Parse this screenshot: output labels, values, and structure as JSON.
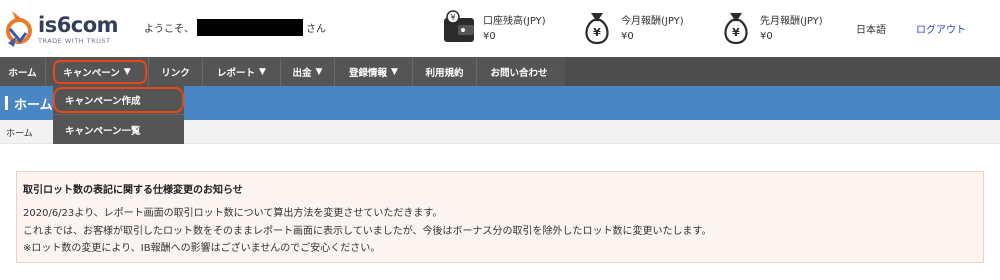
{
  "header": {
    "logo": {
      "name": "is6com",
      "tagline": "TRADE WITH TRUST"
    },
    "welcome_prefix": "ようこそ、",
    "welcome_suffix": "さん",
    "balances": [
      {
        "label": "口座残高(JPY)",
        "value": "¥0",
        "icon": "wallet-icon"
      },
      {
        "label": "今月報酬(JPY)",
        "value": "¥0",
        "icon": "money-bag-icon"
      },
      {
        "label": "先月報酬(JPY)",
        "value": "¥0",
        "icon": "money-bag-icon"
      }
    ],
    "language": "日本語",
    "logout": "ログアウト"
  },
  "nav": {
    "items": [
      {
        "label": "ホーム",
        "has_caret": false
      },
      {
        "label": "キャンペーン",
        "has_caret": true
      },
      {
        "label": "リンク",
        "has_caret": false
      },
      {
        "label": "レポート",
        "has_caret": true
      },
      {
        "label": "出金",
        "has_caret": true
      },
      {
        "label": "登録情報",
        "has_caret": true
      },
      {
        "label": "利用規約",
        "has_caret": false
      },
      {
        "label": "お問い合わせ",
        "has_caret": false
      }
    ],
    "caret": "▼"
  },
  "dropdown": {
    "items": [
      {
        "label": "キャンペーン作成"
      },
      {
        "label": "キャンペーン一覧"
      }
    ]
  },
  "page": {
    "title": "ホーム",
    "breadcrumb": "ホーム"
  },
  "notice": {
    "title": "取引ロット数の表記に関する仕様変更のお知らせ",
    "lines": [
      "2020/6/23より、レポート画面の取引ロット数について算出方法を変更させていただきます。",
      "これまでは、お客様が取引したロット数をそのままレポート画面に表示していましたが、今後はボーナス分の取引を除外したロット数に変更いたします。",
      "※ロット数の変更により、IB報酬への影響はございませんのでご安心ください。"
    ]
  },
  "colors": {
    "nav_bg": "#555555",
    "title_bar": "#4a86c3",
    "highlight": "#e8471e",
    "logout_link": "#2a45c4",
    "notice_bg": "#fdf4f1"
  }
}
